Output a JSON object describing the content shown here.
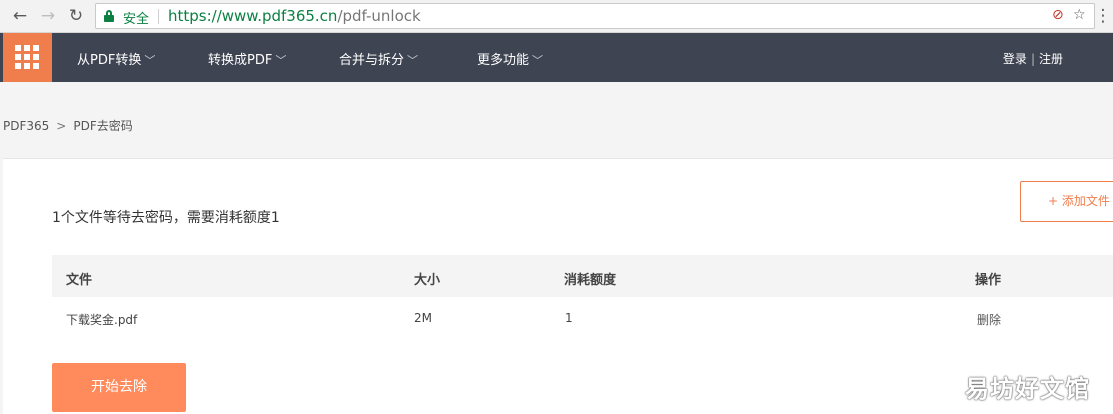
{
  "browser": {
    "secure_label": "安全",
    "url_host": "https://www.pdf365.cn",
    "url_path": "/pdf-unlock",
    "back_icon": "←",
    "forward_icon": "→",
    "reload_icon": "↻",
    "ext_icon": "⊘",
    "star_icon": "☆",
    "menu_icon": "⋮"
  },
  "nav": {
    "items": [
      {
        "label": "从PDF转换"
      },
      {
        "label": "转换成PDF"
      },
      {
        "label": "合并与拆分"
      },
      {
        "label": "更多功能"
      }
    ],
    "chevron": "﹀",
    "login": "登录",
    "divider": "|",
    "register": "注册"
  },
  "breadcrumb": {
    "root": "PDF365",
    "sep": ">",
    "current": "PDF去密码"
  },
  "main": {
    "status": "1个文件等待去密码，需要消耗额度1",
    "add_button": "+ 添加文件",
    "table": {
      "headers": [
        "文件",
        "大小",
        "消耗额度",
        "操作"
      ],
      "rows": [
        {
          "file": "下载奖金.pdf",
          "size": "2M",
          "cost": "1",
          "action": "删除"
        }
      ]
    },
    "start_button": "开始去除"
  },
  "watermark": "易坊好文馆",
  "colors": {
    "accent": "#f07d4c",
    "button": "#ff8a5c",
    "nav_bg": "#3e4451",
    "secure_green": "#0b8043"
  }
}
